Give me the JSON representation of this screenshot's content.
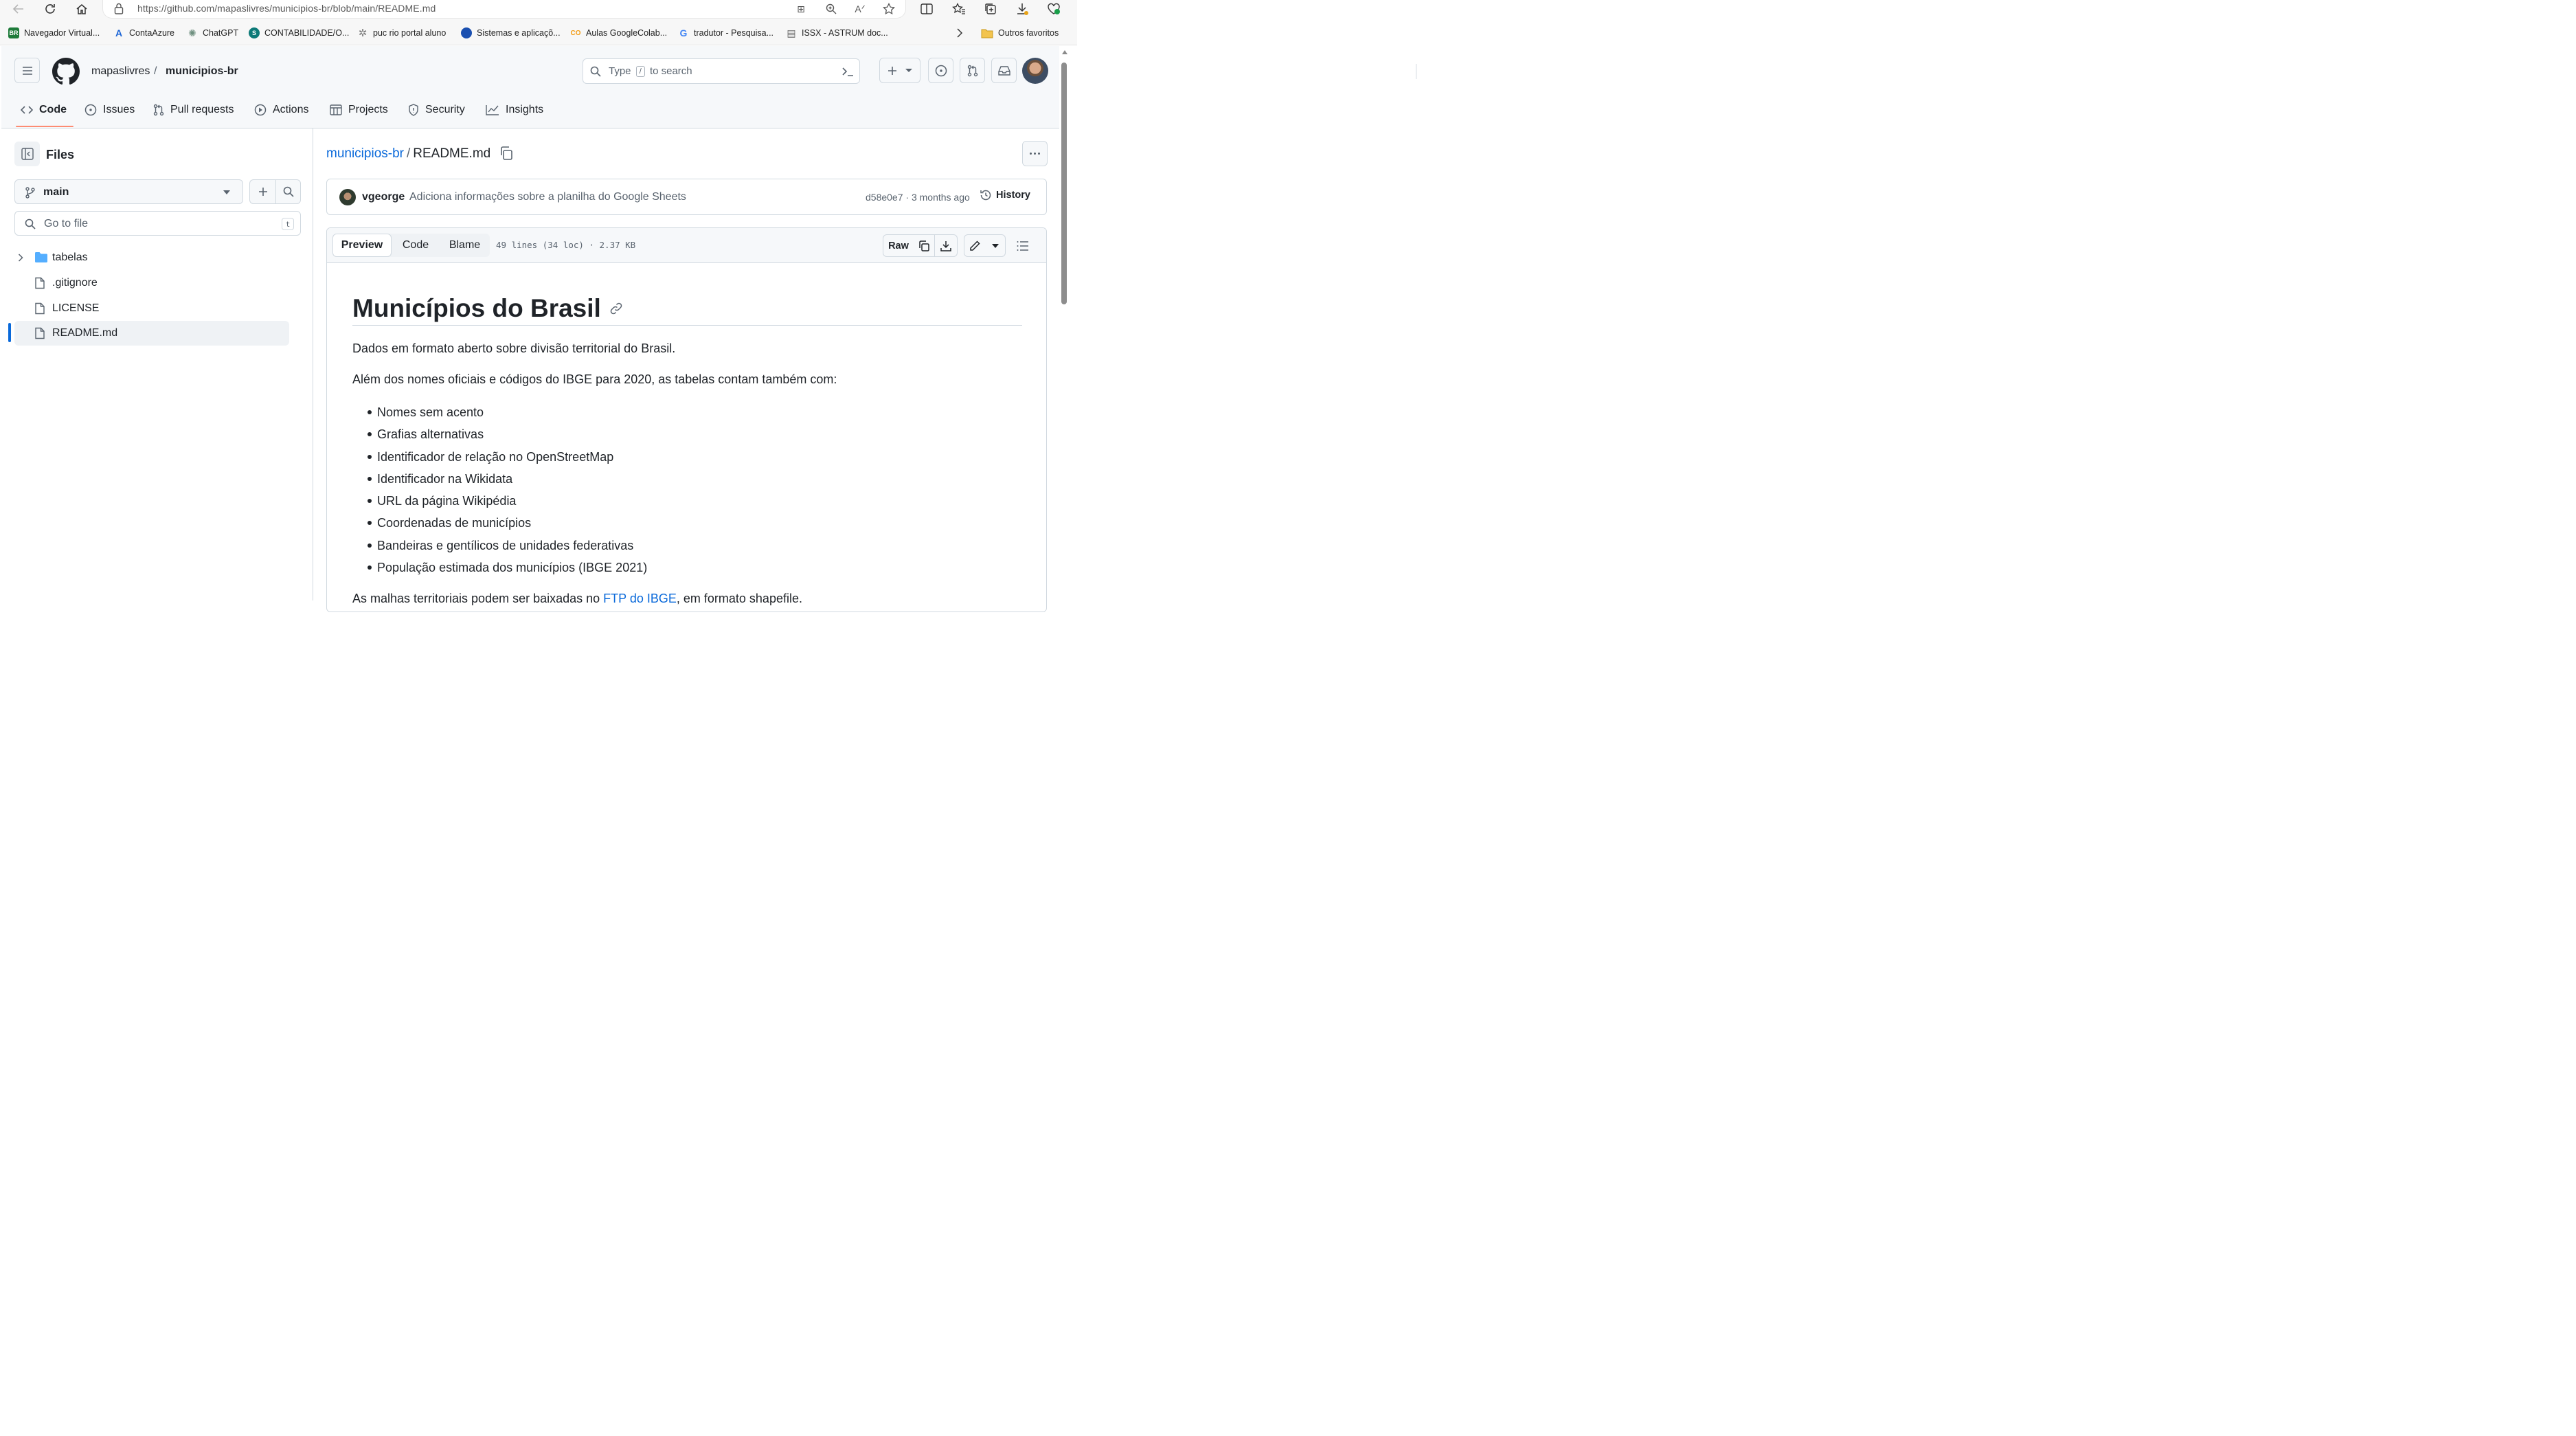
{
  "browser": {
    "url": "https://github.com/mapaslivres/municipios-br/blob/main/README.md",
    "bookmarks": [
      {
        "label": "Navegador Virtual...",
        "icon": "gov-br-icon",
        "color": "#1e7b3a",
        "glyph": "BR"
      },
      {
        "label": "ContaAzure",
        "icon": "azure-icon",
        "color": "#1b64d6",
        "glyph": "A"
      },
      {
        "label": "ChatGPT",
        "icon": "chatgpt-icon",
        "color": "#7a9a8a",
        "glyph": "✺"
      },
      {
        "label": "CONTABILIDADE/O...",
        "icon": "sharepoint-icon",
        "color": "#0d7a78",
        "glyph": "S"
      },
      {
        "label": "puc rio portal aluno",
        "icon": "puc-icon",
        "color": "#8a8a8a",
        "glyph": "✲"
      },
      {
        "label": "Sistemas e aplicaçõ...",
        "icon": "globe-icon",
        "color": "#1a4fb0",
        "glyph": "●"
      },
      {
        "label": "Aulas GoogleColab...",
        "icon": "colab-icon",
        "color": "#f29b13",
        "glyph": "CO"
      },
      {
        "label": "tradutor - Pesquisa...",
        "icon": "google-icon",
        "color": "#4285f4",
        "glyph": "G"
      },
      {
        "label": "ISSX - ASTRUM doc...",
        "icon": "document-icon",
        "color": "#8a8a8a",
        "glyph": "▤"
      }
    ],
    "other_favorites": "Outros favoritos"
  },
  "header": {
    "owner": "mapaslivres",
    "separator": "/",
    "repo": "municipios-br",
    "search_type": "Type",
    "search_key": "/",
    "search_rest": "to search",
    "tabs": [
      {
        "label": "Code",
        "icon": "code-icon"
      },
      {
        "label": "Issues",
        "icon": "issue-icon"
      },
      {
        "label": "Pull requests",
        "icon": "pull-request-icon"
      },
      {
        "label": "Actions",
        "icon": "play-icon"
      },
      {
        "label": "Projects",
        "icon": "table-icon"
      },
      {
        "label": "Security",
        "icon": "shield-icon"
      },
      {
        "label": "Insights",
        "icon": "graph-icon"
      }
    ]
  },
  "sidebar": {
    "title": "Files",
    "branch": "main",
    "goto_placeholder": "Go to file",
    "goto_shortcut": "t",
    "items": [
      {
        "name": "tabelas",
        "type": "folder"
      },
      {
        "name": ".gitignore",
        "type": "file"
      },
      {
        "name": "LICENSE",
        "type": "file"
      },
      {
        "name": "README.md",
        "type": "file",
        "active": true
      }
    ]
  },
  "main": {
    "breadcrumb_repo": "municipios-br",
    "breadcrumb_sep": "/",
    "breadcrumb_file": "README.md",
    "commit": {
      "author": "vgeorge",
      "message": "Adiciona informações sobre a planilha do Google Sheets",
      "meta": "d58e0e7 · 3 months ago",
      "history": "History"
    },
    "toolbar": {
      "preview": "Preview",
      "code": "Code",
      "blame": "Blame",
      "info": "49 lines (34 loc) · 2.37 KB",
      "raw": "Raw"
    },
    "readme": {
      "title": "Municípios do Brasil",
      "p1": "Dados em formato aberto sobre divisão territorial do Brasil.",
      "p2": "Além dos nomes oficiais e códigos do IBGE para 2020, as tabelas contam também com:",
      "list": [
        "Nomes sem acento",
        "Grafias alternativas",
        "Identificador de relação no OpenStreetMap",
        "Identificador na Wikidata",
        "URL da página Wikipédia",
        "Coordenadas de municípios",
        "Bandeiras e gentílicos de unidades federativas",
        "População estimada dos municípios (IBGE 2021)"
      ],
      "p3_before": "As malhas territoriais podem ser baixadas no ",
      "p3_link": "FTP do IBGE",
      "p3_after": ", em formato shapefile."
    }
  },
  "colors": {
    "accent_link": "#0969da",
    "tab_underline": "#fd8c73",
    "folder": "#54aeff"
  }
}
